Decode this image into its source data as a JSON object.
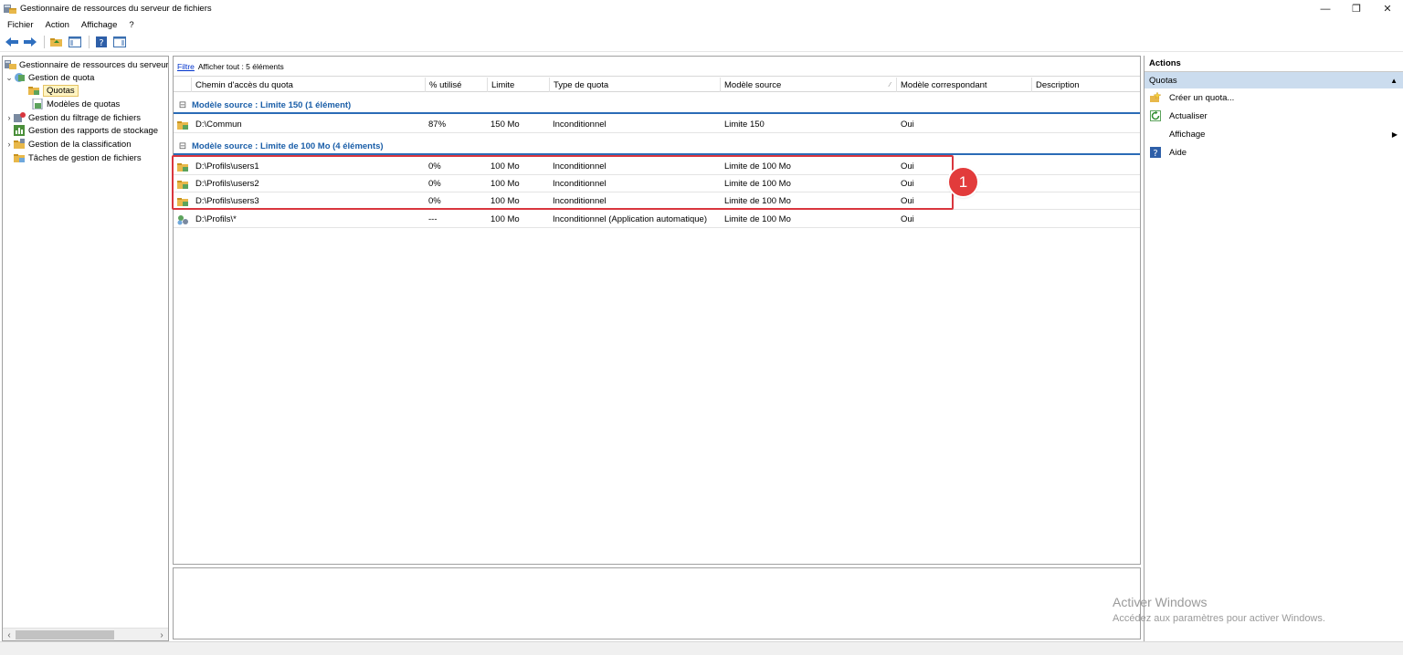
{
  "window": {
    "title": "Gestionnaire de ressources du serveur de fichiers"
  },
  "menu": [
    "Fichier",
    "Action",
    "Affichage",
    "?"
  ],
  "toolbar": [
    "back-arrow-icon",
    "forward-arrow-icon",
    "up-folder-icon",
    "show-hide-tree-icon",
    "help-icon",
    "show-hide-action-pane-icon"
  ],
  "tree": [
    {
      "label": "Gestionnaire de ressources du serveur",
      "indent": 0,
      "expander": "",
      "icon": "server-icon"
    },
    {
      "label": "Gestion de quota",
      "indent": 1,
      "expander": "⌄",
      "icon": "quota-management-icon"
    },
    {
      "label": "Quotas",
      "indent": 2,
      "expander": "",
      "icon": "quota-folder-icon",
      "selected": true
    },
    {
      "label": "Modèles de quotas",
      "indent": 2,
      "expander": "",
      "icon": "quota-template-icon"
    },
    {
      "label": "Gestion du filtrage de fichiers",
      "indent": 1,
      "expander": "›",
      "icon": "file-screen-icon"
    },
    {
      "label": "Gestion des rapports de stockage",
      "indent": 1,
      "expander": "",
      "icon": "storage-report-icon"
    },
    {
      "label": "Gestion de la classification",
      "indent": 1,
      "expander": "›",
      "icon": "classification-icon"
    },
    {
      "label": "Tâches de gestion de fichiers",
      "indent": 1,
      "expander": "",
      "icon": "file-task-icon"
    }
  ],
  "filter": {
    "link": "Filtre",
    "text": "Afficher tout : 5 éléments"
  },
  "columns": [
    "Chemin d'accès du quota",
    "% utilisé",
    "Limite",
    "Type de quota",
    "Modèle source",
    "Modèle correspondant",
    "Description"
  ],
  "groups": [
    {
      "title": "Modèle source : Limite 150 (1 élément)",
      "rows": [
        {
          "path": "D:\\Commun",
          "used": "87%",
          "limit": "150 Mo",
          "type": "Inconditionnel",
          "template": "Limite 150",
          "match": "Oui",
          "description": "",
          "icon": "quota-folder-icon"
        }
      ]
    },
    {
      "title": "Modèle source : Limite de 100 Mo (4 éléments)",
      "rows": [
        {
          "path": "D:\\Profils\\users1",
          "used": "0%",
          "limit": "100 Mo",
          "type": "Inconditionnel",
          "template": "Limite de 100 Mo",
          "match": "Oui",
          "description": "",
          "icon": "quota-folder-icon"
        },
        {
          "path": "D:\\Profils\\users2",
          "used": "0%",
          "limit": "100 Mo",
          "type": "Inconditionnel",
          "template": "Limite de 100 Mo",
          "match": "Oui",
          "description": "",
          "icon": "quota-folder-icon"
        },
        {
          "path": "D:\\Profils\\users3",
          "used": "0%",
          "limit": "100 Mo",
          "type": "Inconditionnel",
          "template": "Limite de 100 Mo",
          "match": "Oui",
          "description": "",
          "icon": "quota-folder-icon"
        },
        {
          "path": "D:\\Profils\\*",
          "used": "---",
          "limit": "100 Mo",
          "type": "Inconditionnel (Application automatique)",
          "template": "Limite de 100 Mo",
          "match": "Oui",
          "description": "",
          "icon": "auto-apply-quota-icon"
        }
      ]
    }
  ],
  "annotation": {
    "badge": "1",
    "color": "#d9363e"
  },
  "actions": {
    "title": "Actions",
    "group": "Quotas",
    "items": [
      {
        "label": "Créer un quota...",
        "icon": "create-quota-icon"
      },
      {
        "label": "Actualiser",
        "icon": "refresh-icon"
      },
      {
        "label": "Affichage",
        "icon": "",
        "submenu": true
      },
      {
        "label": "Aide",
        "icon": "help-icon"
      }
    ]
  },
  "watermark": {
    "line1": "Activer Windows",
    "line2": "Accédez aux paramètres pour activer Windows."
  },
  "colors": {
    "group_header": "#1a5ea8",
    "selection": "#fff4c2",
    "actions_group_bg": "#cbdcee",
    "highlight": "#d9363e"
  }
}
